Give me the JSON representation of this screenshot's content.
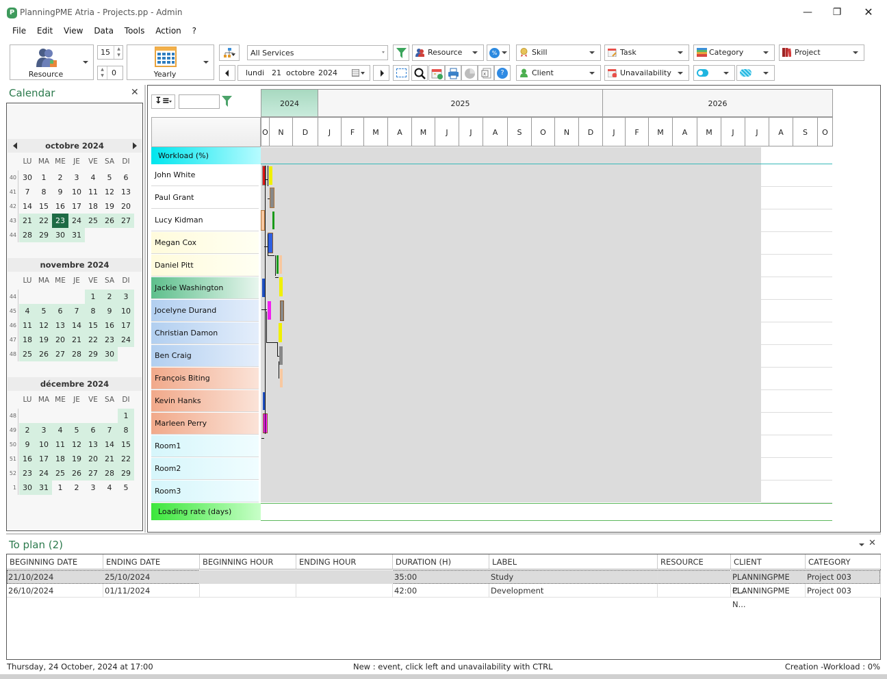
{
  "window": {
    "title": "PlanningPME Atria - Projects.pp - Admin",
    "controls": [
      "minimize",
      "restore",
      "close"
    ]
  },
  "menu": [
    "File",
    "Edit",
    "View",
    "Data",
    "Tools",
    "Action",
    "?"
  ],
  "toolbar": {
    "view_mode": "Resource",
    "spin_top": "15",
    "spin_bottom": "0",
    "period": "Yearly",
    "services": "All Services",
    "resource_filter": "Resource",
    "date": {
      "weekday": "lundi",
      "day": "21",
      "month": "octobre",
      "year": "2024"
    },
    "skill": "Skill",
    "task": "Task",
    "category": "Category",
    "project": "Project",
    "client": "Client",
    "unavailability": "Unavailability"
  },
  "calendar": {
    "title": "Calendar",
    "dow": [
      "LU",
      "MA",
      "ME",
      "JE",
      "VE",
      "SA",
      "DI"
    ],
    "months": [
      {
        "title": "octobre 2024",
        "weeks": [
          {
            "wk": "40",
            "days": [
              "30",
              "1",
              "2",
              "3",
              "4",
              "5",
              "6"
            ],
            "hl": [
              0,
              0,
              0,
              0,
              0,
              0,
              0
            ]
          },
          {
            "wk": "41",
            "days": [
              "7",
              "8",
              "9",
              "10",
              "11",
              "12",
              "13"
            ],
            "hl": [
              0,
              0,
              0,
              0,
              0,
              0,
              0
            ]
          },
          {
            "wk": "42",
            "days": [
              "14",
              "15",
              "16",
              "17",
              "18",
              "19",
              "20"
            ],
            "hl": [
              0,
              0,
              0,
              0,
              0,
              0,
              0
            ]
          },
          {
            "wk": "43",
            "days": [
              "21",
              "22",
              "23",
              "24",
              "25",
              "26",
              "27"
            ],
            "hl": [
              1,
              1,
              2,
              1,
              1,
              1,
              1
            ]
          },
          {
            "wk": "44",
            "days": [
              "28",
              "29",
              "30",
              "31",
              "",
              "",
              ""
            ],
            "hl": [
              1,
              1,
              1,
              1,
              0,
              0,
              0
            ]
          }
        ]
      },
      {
        "title": "novembre 2024",
        "weeks": [
          {
            "wk": "44",
            "days": [
              "",
              "",
              "",
              "",
              "1",
              "2",
              "3"
            ],
            "hl": [
              0,
              0,
              0,
              0,
              1,
              1,
              1
            ]
          },
          {
            "wk": "45",
            "days": [
              "4",
              "5",
              "6",
              "7",
              "8",
              "9",
              "10"
            ],
            "hl": [
              1,
              1,
              1,
              1,
              1,
              1,
              1
            ]
          },
          {
            "wk": "46",
            "days": [
              "11",
              "12",
              "13",
              "14",
              "15",
              "16",
              "17"
            ],
            "hl": [
              1,
              1,
              1,
              1,
              1,
              1,
              1
            ]
          },
          {
            "wk": "47",
            "days": [
              "18",
              "19",
              "20",
              "21",
              "22",
              "23",
              "24"
            ],
            "hl": [
              1,
              1,
              1,
              1,
              1,
              1,
              1
            ]
          },
          {
            "wk": "48",
            "days": [
              "25",
              "26",
              "27",
              "28",
              "29",
              "30",
              ""
            ],
            "hl": [
              1,
              1,
              1,
              1,
              1,
              1,
              0
            ]
          }
        ]
      },
      {
        "title": "décembre 2024",
        "weeks": [
          {
            "wk": "48",
            "days": [
              "",
              "",
              "",
              "",
              "",
              "",
              "1"
            ],
            "hl": [
              0,
              0,
              0,
              0,
              0,
              0,
              1
            ]
          },
          {
            "wk": "49",
            "days": [
              "2",
              "3",
              "4",
              "5",
              "6",
              "7",
              "8"
            ],
            "hl": [
              1,
              1,
              1,
              1,
              1,
              1,
              1
            ]
          },
          {
            "wk": "50",
            "days": [
              "9",
              "10",
              "11",
              "12",
              "13",
              "14",
              "15"
            ],
            "hl": [
              1,
              1,
              1,
              1,
              1,
              1,
              1
            ]
          },
          {
            "wk": "51",
            "days": [
              "16",
              "17",
              "18",
              "19",
              "20",
              "21",
              "22"
            ],
            "hl": [
              1,
              1,
              1,
              1,
              1,
              1,
              1
            ]
          },
          {
            "wk": "52",
            "days": [
              "23",
              "24",
              "25",
              "26",
              "27",
              "28",
              "29"
            ],
            "hl": [
              1,
              1,
              1,
              1,
              1,
              1,
              1
            ]
          },
          {
            "wk": "1",
            "days": [
              "30",
              "31",
              "1",
              "2",
              "3",
              "4",
              "5"
            ],
            "hl": [
              1,
              1,
              0,
              0,
              0,
              0,
              0
            ]
          }
        ]
      }
    ]
  },
  "gantt": {
    "years": [
      "2024",
      "2025",
      "2026"
    ],
    "months": [
      "O",
      "N",
      "D",
      "J",
      "F",
      "M",
      "A",
      "M",
      "J",
      "J",
      "A",
      "S",
      "O",
      "N",
      "D",
      "J",
      "F",
      "M",
      "A",
      "M",
      "J",
      "J",
      "A",
      "S",
      "O"
    ],
    "workload_label": "Workload (%)",
    "loading_label": "Loading rate (days)",
    "rows": [
      {
        "name": "John White",
        "group": "white"
      },
      {
        "name": "Paul Grant",
        "group": "white"
      },
      {
        "name": "Lucy Kidman",
        "group": "white"
      },
      {
        "name": "Megan Cox",
        "group": "yellow"
      },
      {
        "name": "Daniel Pitt",
        "group": "yellow"
      },
      {
        "name": "Jackie Washington",
        "group": "green"
      },
      {
        "name": "Jocelyne Durand",
        "group": "blue"
      },
      {
        "name": "Christian Damon",
        "group": "blue"
      },
      {
        "name": "Ben Craig",
        "group": "blue"
      },
      {
        "name": "François Biting",
        "group": "orange"
      },
      {
        "name": "Kevin Hanks",
        "group": "orange"
      },
      {
        "name": "Marleen Perry",
        "group": "orange"
      },
      {
        "name": "Room1",
        "group": "cyan"
      },
      {
        "name": "Room2",
        "group": "cyan"
      },
      {
        "name": "Room3",
        "group": "cyan"
      }
    ]
  },
  "to_plan": {
    "title": "To plan (2)",
    "columns": [
      "BEGINNING DATE",
      "ENDING DATE",
      "BEGINNING HOUR",
      "ENDING HOUR",
      "DURATION (H)",
      "LABEL",
      "RESOURCE",
      "CLIENT",
      "CATEGORY"
    ],
    "rows": [
      [
        "21/10/2024",
        "25/10/2024",
        "",
        "",
        "35:00",
        "Study",
        "",
        "PLANNINGPME C...",
        "Project 003"
      ],
      [
        "26/10/2024",
        "01/11/2024",
        "",
        "",
        "42:00",
        "Development",
        "",
        "PLANNINGPME N...",
        "Project 003"
      ]
    ]
  },
  "status": {
    "left": "Thursday, 24 October, 2024 at 17:00",
    "center": "New : event, click left and unavailability with CTRL",
    "right": "Creation -Workload : 0%"
  }
}
